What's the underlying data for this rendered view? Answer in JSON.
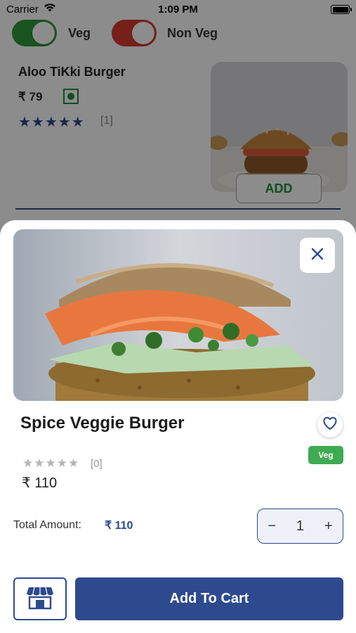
{
  "status_bar": {
    "carrier": "Carrier",
    "time": "1:09 PM"
  },
  "filters": {
    "veg": {
      "label": "Veg",
      "on": true,
      "color": "#2e9a3b"
    },
    "non_veg": {
      "label": "Non Veg",
      "on": true,
      "color": "#d93a2f"
    }
  },
  "background_item": {
    "name": "Aloo TiKki Burger",
    "price": "₹ 79",
    "stars": "★★★★★",
    "review_count": "[1]",
    "add_label": "ADD"
  },
  "detail": {
    "name": "Spice Veggie Burger",
    "badge": "Veg",
    "stars": "★★★★★",
    "review_count": "[0]",
    "price": "₹ 110",
    "total_label": "Total Amount:",
    "total_value": "₹ 110",
    "quantity": "1",
    "decrement": "−",
    "increment": "+",
    "add_to_cart": "Add To Cart"
  },
  "colors": {
    "primary": "#2e4a8f",
    "veg_green": "#3eaa52",
    "overlay": "rgba(0,0,0,0.45)"
  },
  "icons": [
    "wifi-icon",
    "battery-icon",
    "veg-mark-icon",
    "close-icon",
    "heart-icon",
    "store-icon"
  ]
}
